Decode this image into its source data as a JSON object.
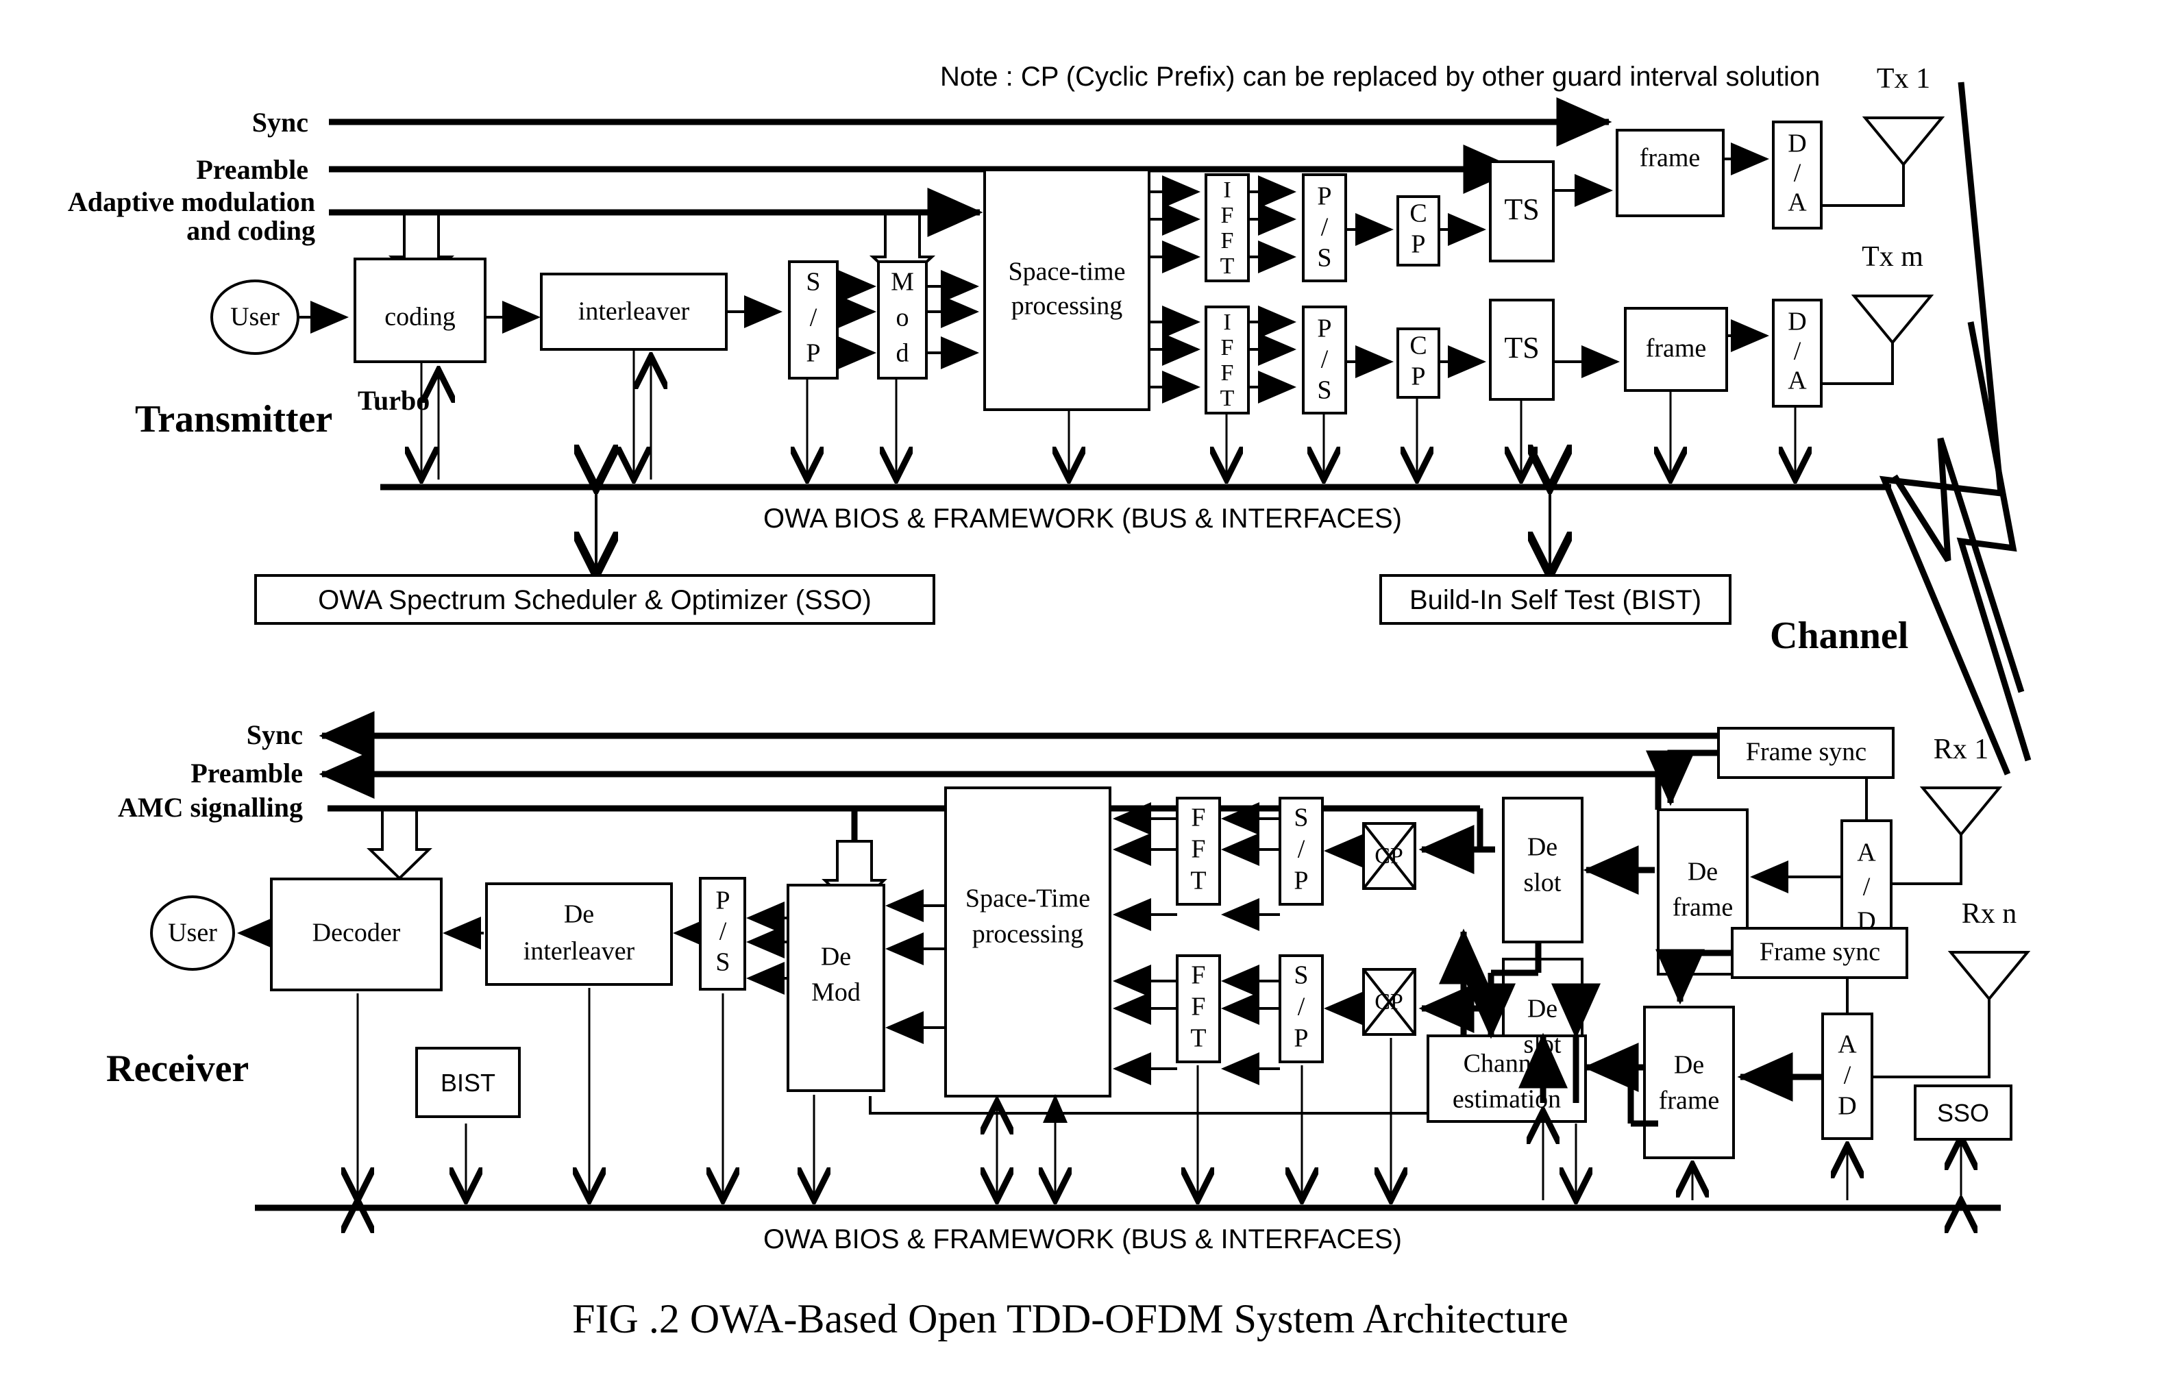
{
  "figure": {
    "caption": "FIG .2   OWA-Based Open TDD-OFDM System Architecture",
    "note": "Note : CP (Cyclic Prefix) can be replaced by other guard interval solution",
    "section_transmitter": "Transmitter",
    "section_receiver": "Receiver",
    "section_channel": "Channel",
    "bus_label_tx": "OWA BIOS & FRAMEWORK (BUS & INTERFACES)",
    "bus_label_rx": "OWA BIOS & FRAMEWORK (BUS & INTERFACES)"
  },
  "transmitter": {
    "signals": {
      "sync": "Sync",
      "preamble": "Preamble",
      "amc_line1": "Adaptive modulation",
      "amc_line2": "and coding",
      "turbo": "Turbo"
    },
    "blocks": {
      "user": "User",
      "coding": "coding",
      "interleaver": "interleaver",
      "sp": "S\n/\nP",
      "sp_chars": [
        "S",
        "/",
        "P"
      ],
      "mod_chars": [
        "M",
        "o",
        "d"
      ],
      "space_time_l1": "Space-time",
      "space_time_l2": "processing",
      "ifft_chars": [
        "I",
        "F",
        "F",
        "T"
      ],
      "ps_chars": [
        "P",
        "/",
        "S"
      ],
      "cp_chars": [
        "C",
        "P"
      ],
      "ts": "TS",
      "frame": "frame",
      "da_chars": [
        "D",
        "/",
        "A"
      ]
    },
    "antennas": {
      "tx1": "Tx 1",
      "txm": "Tx m"
    },
    "sso_box": "OWA Spectrum Scheduler & Optimizer (SSO)",
    "bist_box": "Build-In Self Test  (BIST)"
  },
  "receiver": {
    "signals": {
      "sync": "Sync",
      "preamble": "Preamble",
      "amc": "AMC  signalling"
    },
    "blocks": {
      "user": "User",
      "decoder": "Decoder",
      "deinterleaver_l1": "De",
      "deinterleaver_l2": "interleaver",
      "ps_chars": [
        "P",
        "/",
        "S"
      ],
      "demod_l1": "De",
      "demod_l2": "Mod",
      "space_time_l1": "Space-Time",
      "space_time_l2": "processing",
      "fft_chars": [
        "F",
        "F",
        "T"
      ],
      "sp_chars": [
        "S",
        "/",
        "P"
      ],
      "cp": "CP",
      "de_slot_l1": "De",
      "de_slot_l2": "slot",
      "de_frame_l1": "De",
      "de_frame_l2": "frame",
      "frame_sync": "Frame sync",
      "ad_chars": [
        "A",
        "/",
        "D"
      ],
      "channel_est_l1": "Channel",
      "channel_est_l2": "estimation",
      "bist": "BIST",
      "sso": "SSO"
    },
    "antennas": {
      "rx1": "Rx 1",
      "rxn": "Rx n"
    }
  },
  "colors": {
    "line": "#000000",
    "background": "#ffffff",
    "box_fill": "#ffffff"
  }
}
